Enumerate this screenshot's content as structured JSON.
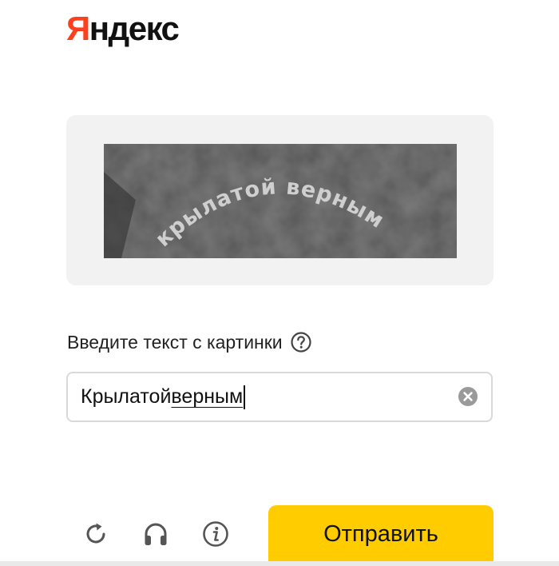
{
  "header": {
    "logo_first": "Я",
    "logo_rest": "ндекс"
  },
  "captcha": {
    "image_text": "крылатой верным"
  },
  "form": {
    "prompt_label": "Введите текст с картинки",
    "input_word1": "Крылатой",
    "input_word2": "верным"
  },
  "toolbar": {
    "submit_label": "Отправить",
    "icons": [
      "refresh-icon",
      "headphones-icon",
      "info-icon"
    ]
  },
  "colors": {
    "brand_red": "#fc3f1d",
    "submit_yellow": "#ffcc00",
    "panel_gray": "#f2f2f2",
    "icon_gray": "#666666"
  }
}
